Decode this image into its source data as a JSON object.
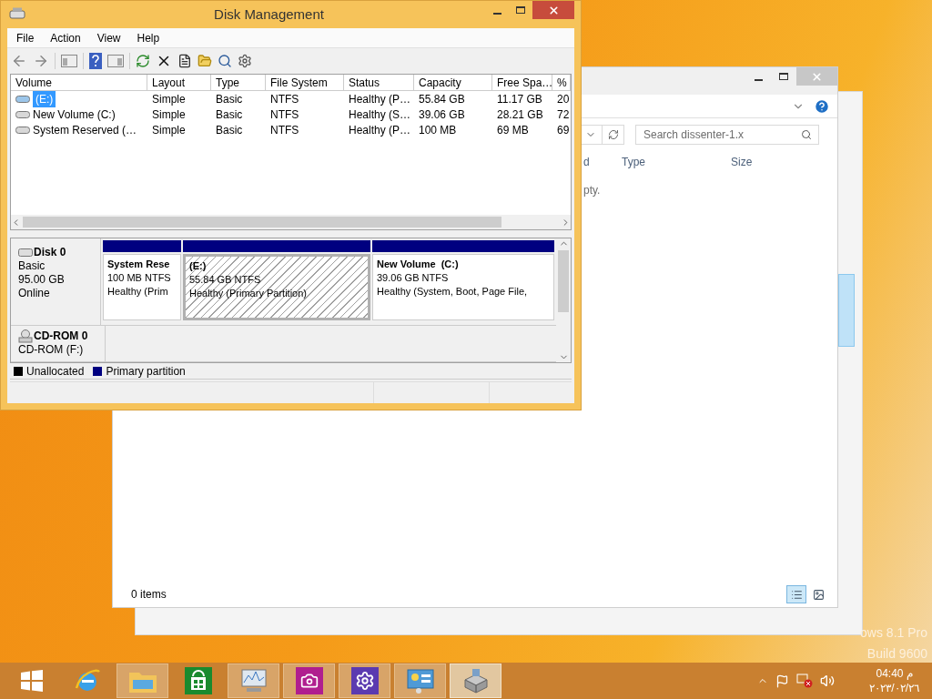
{
  "disk_management": {
    "title": "Disk Management",
    "menu": [
      "File",
      "Action",
      "View",
      "Help"
    ],
    "volume_table": {
      "columns": [
        "Volume",
        "Layout",
        "Type",
        "File System",
        "Status",
        "Capacity",
        "Free Spa…",
        "%"
      ],
      "rows": [
        {
          "cells": [
            "(E:)",
            "Simple",
            "Basic",
            "NTFS",
            "Healthy (P…",
            "55.84 GB",
            "11.17 GB",
            "20"
          ],
          "selected": true
        },
        {
          "cells": [
            "New Volume (C:)",
            "Simple",
            "Basic",
            "NTFS",
            "Healthy (S…",
            "39.06 GB",
            "28.21 GB",
            "72"
          ],
          "selected": false
        },
        {
          "cells": [
            "System Reserved (…",
            "Simple",
            "Basic",
            "NTFS",
            "Healthy (P…",
            "100 MB",
            "69 MB",
            "69"
          ],
          "selected": false
        }
      ]
    },
    "disks": [
      {
        "kind": "disk",
        "name": "Disk 0",
        "lines": [
          "Basic",
          "95.00 GB",
          "Online"
        ],
        "partitions": [
          {
            "name": "System Rese",
            "size": "100 MB NTFS",
            "status": "Healthy (Prim",
            "selected": false
          },
          {
            "name": "(E:)",
            "size": "55.84 GB NTFS",
            "status": "Healthy (Primary Partition)",
            "selected": true
          },
          {
            "name": "New Volume  (C:)",
            "size": "39.06 GB NTFS",
            "status": "Healthy (System, Boot, Page File,",
            "selected": false
          }
        ]
      },
      {
        "kind": "cdrom",
        "name": "CD-ROM 0",
        "lines": [
          "CD-ROM (F:)"
        ]
      }
    ],
    "legend": [
      {
        "label": "Unallocated",
        "color": "#000000"
      },
      {
        "label": "Primary partition",
        "color": "#000080"
      }
    ]
  },
  "explorer": {
    "search": {
      "placeholder": "Search dissenter-1.x"
    },
    "columns": [
      "d",
      "Type",
      "Size"
    ],
    "empty_message": "pty.",
    "status": "0 items"
  },
  "desktop_watermark": [
    "ows 8.1 Pro",
    "Build 9600"
  ],
  "taskbar": {
    "apps": [
      {
        "kind": "start",
        "running": false,
        "selected": false
      },
      {
        "kind": "browser",
        "running": false,
        "selected": false
      },
      {
        "kind": "folder",
        "running": true,
        "selected": false
      },
      {
        "kind": "store",
        "running": false,
        "selected": false
      },
      {
        "kind": "monitor",
        "running": true,
        "selected": false
      },
      {
        "kind": "camera",
        "running": true,
        "selected": false
      },
      {
        "kind": "settings",
        "running": true,
        "selected": false
      },
      {
        "kind": "control",
        "running": true,
        "selected": false
      },
      {
        "kind": "disks",
        "running": true,
        "selected": true
      }
    ],
    "clock": {
      "time": "04:40 م",
      "date": "٢٠٢٣/٠٢/٢٦"
    }
  }
}
